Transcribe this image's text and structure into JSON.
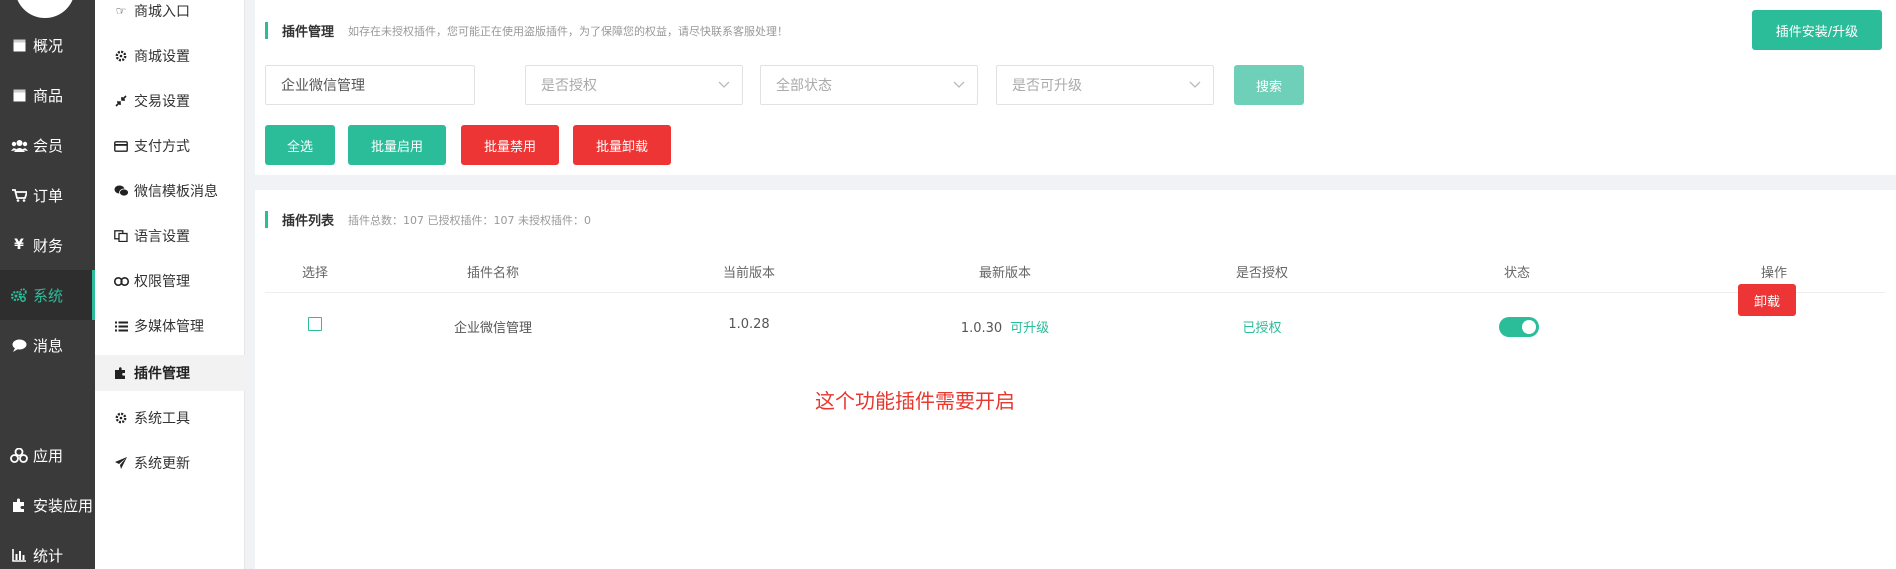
{
  "nav_primary": {
    "items": [
      {
        "label": "概况",
        "icon": "overview-icon"
      },
      {
        "label": "商品",
        "icon": "goods-icon"
      },
      {
        "label": "会员",
        "icon": "members-icon"
      },
      {
        "label": "订单",
        "icon": "cart-icon"
      },
      {
        "label": "财务",
        "icon": "yen-icon"
      },
      {
        "label": "系统",
        "icon": "gears-icon",
        "active": true
      },
      {
        "label": "消息",
        "icon": "chat-bubble-icon"
      },
      {
        "label": "应用",
        "icon": "cubes-icon"
      },
      {
        "label": "安装应用",
        "icon": "puzzle-icon"
      },
      {
        "label": "统计",
        "icon": "bar-chart-icon"
      }
    ]
  },
  "nav_secondary": {
    "items": [
      {
        "label": "商城入口",
        "icon": "hand-point-icon"
      },
      {
        "label": "商城设置",
        "icon": "gear-icon"
      },
      {
        "label": "交易设置",
        "icon": "compress-arrows-icon"
      },
      {
        "label": "支付方式",
        "icon": "credit-card-icon"
      },
      {
        "label": "微信模板消息",
        "icon": "wechat-icon"
      },
      {
        "label": "语言设置",
        "icon": "language-icon"
      },
      {
        "label": "权限管理",
        "icon": "link-icon"
      },
      {
        "label": "多媒体管理",
        "icon": "list-icon"
      },
      {
        "label": "插件管理",
        "icon": "plugin-icon",
        "active": true
      },
      {
        "label": "系统工具",
        "icon": "gear-icon"
      },
      {
        "label": "系统更新",
        "icon": "paper-plane-icon"
      }
    ]
  },
  "plugin_manage": {
    "title": "插件管理",
    "notice": "如存在未授权插件，您可能正在使用盗版插件，为了保障您的权益，请尽快联系客服处理！",
    "install_button": "插件安装/升级",
    "filters": {
      "keyword_value": "企业微信管理",
      "authorized_placeholder": "是否授权",
      "status_placeholder": "全部状态",
      "upgradable_placeholder": "是否可升级",
      "search_button": "搜索"
    },
    "actions": {
      "select_all": "全选",
      "batch_enable": "批量启用",
      "batch_disable": "批量禁用",
      "batch_uninstall": "批量卸载"
    }
  },
  "plugin_list": {
    "title": "插件列表",
    "summary": "插件总数：107 已授权插件：107 未授权插件：0",
    "columns": [
      "选择",
      "插件名称",
      "当前版本",
      "最新版本",
      "是否授权",
      "状态",
      "操作"
    ],
    "rows": [
      {
        "name": "企业微信管理",
        "current_version": "1.0.28",
        "latest_version": "1.0.30",
        "upgrade_tag": "可升级",
        "authorized": "已授权",
        "enabled": true,
        "action": "卸载"
      }
    ]
  },
  "annotation": "这个功能插件需要开启",
  "colors": {
    "accent": "#2bbd9a",
    "danger": "#ee3535",
    "sidebar": "#3a3a3a",
    "annotation": "#e8372e"
  }
}
